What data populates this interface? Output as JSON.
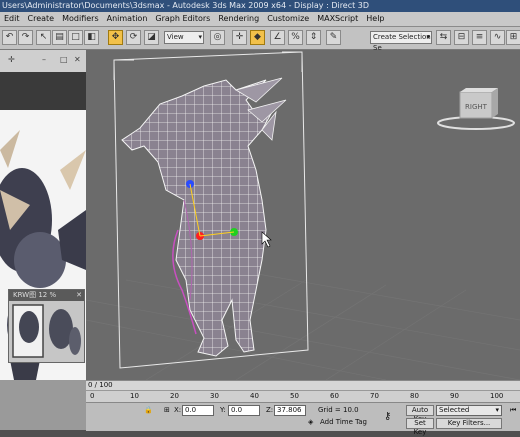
{
  "window": {
    "title": "Users\\Administrator\\Documents\\3dsmax   -   Autodesk 3ds Max  2009 x64   -   Display : Direct 3D"
  },
  "menu": [
    "Edit",
    "Create",
    "Modifiers",
    "Animation",
    "Graph Editors",
    "Rendering",
    "Customize",
    "MAXScript",
    "Help"
  ],
  "toolbar": {
    "ref_coord": "View",
    "selection_set": "Create Selection Se"
  },
  "viewcube": {
    "label": "RIGHT"
  },
  "reference_window": {
    "title": "KRW图 12 %"
  },
  "timeline": {
    "frame_position": "0 / 100",
    "ticks": [
      "0",
      "10",
      "20",
      "30",
      "40",
      "50",
      "60",
      "70",
      "80",
      "90",
      "100"
    ]
  },
  "status": {
    "x_label": "X:",
    "x_value": "0.0",
    "y_label": "Y:",
    "y_value": "0.0",
    "z_label": "Z:",
    "z_value": "37.806",
    "grid": "Grid = 10.0",
    "autokey": "Auto Key",
    "selected": "Selected",
    "setkey": "Set Key",
    "keyfilters": "Key Filters...",
    "add_time_tag": "Add Time Tag"
  }
}
